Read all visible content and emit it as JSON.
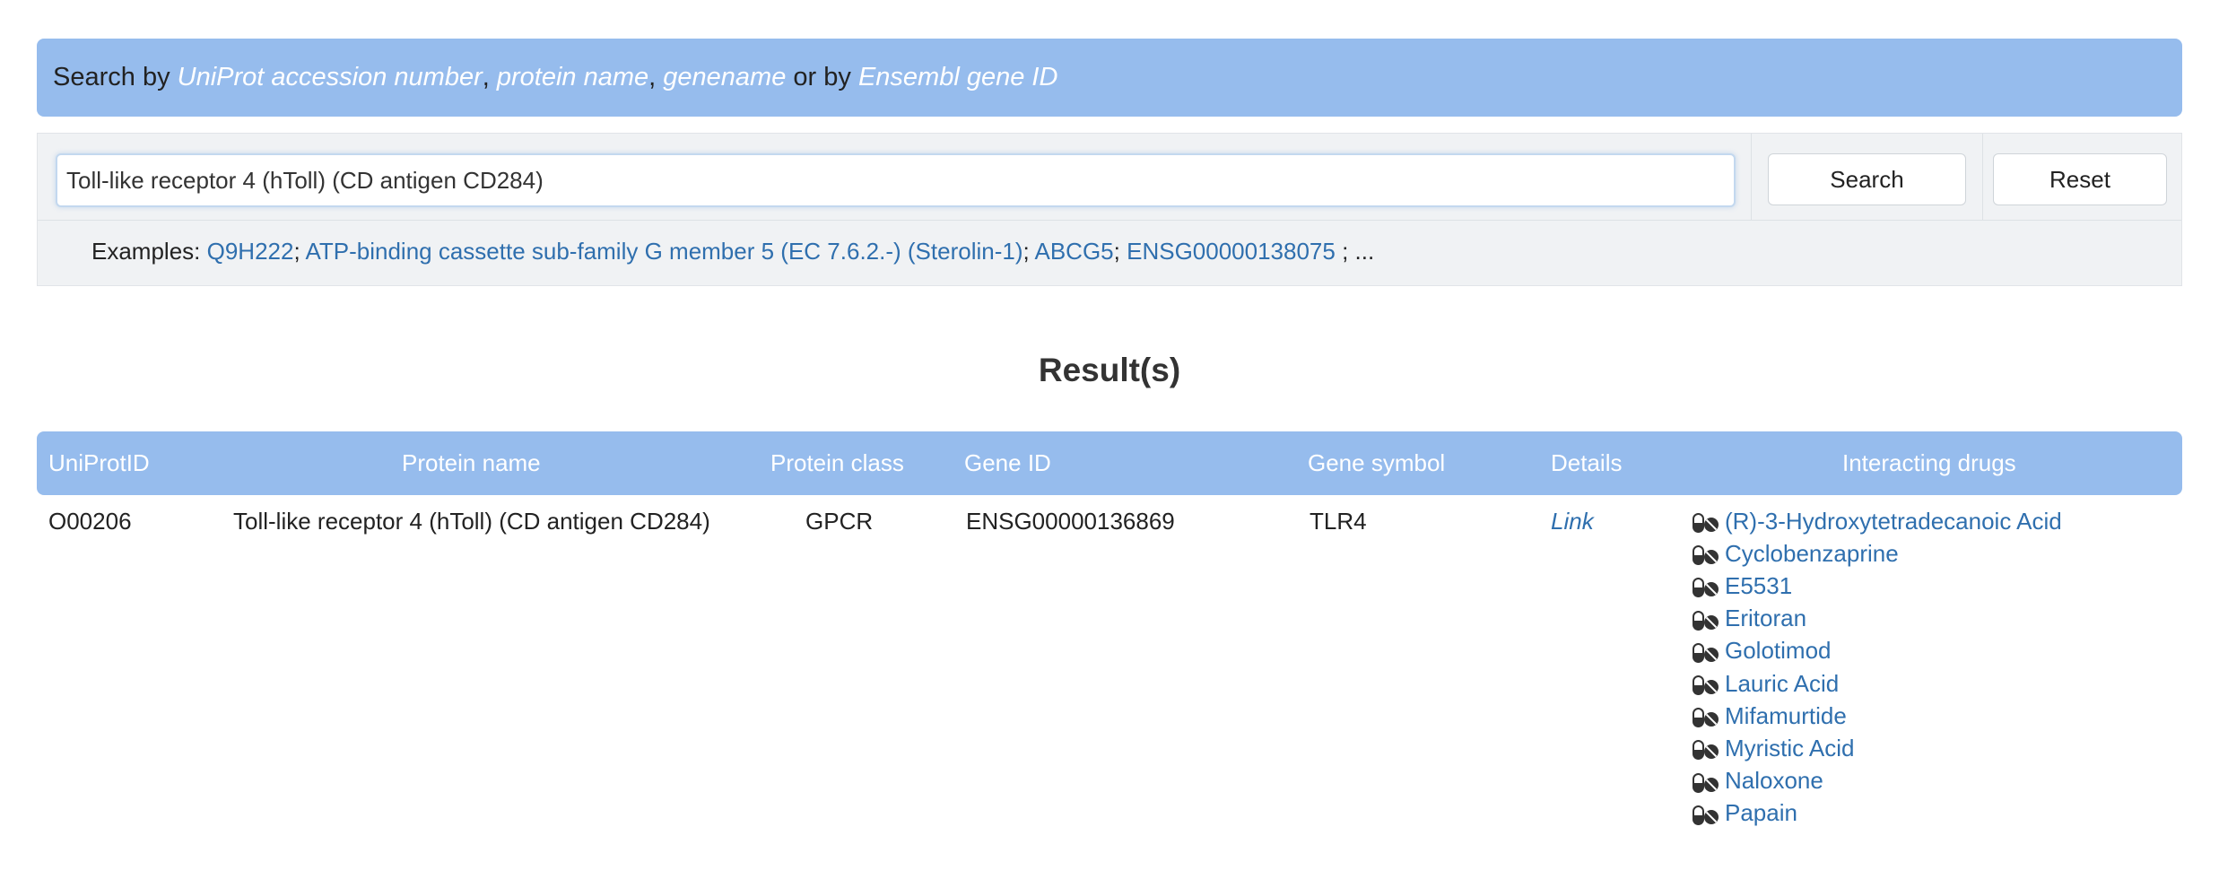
{
  "banner": {
    "prefix": "Search by ",
    "term1": "UniProt accession number",
    "sep1": ", ",
    "term2": "protein name",
    "sep2": ", ",
    "term3": "genename",
    "sep3": " or by ",
    "term4": "Ensembl gene ID"
  },
  "search": {
    "value": "Toll-like receptor 4 (hToll) (CD antigen CD284)",
    "search_label": "Search",
    "reset_label": "Reset"
  },
  "examples": {
    "label": "Examples: ",
    "items": [
      "Q9H222",
      "ATP-binding cassette sub-family G member 5 (EC 7.6.2.-) (Sterolin-1)",
      "ABCG5",
      "ENSG00000138075"
    ],
    "sep": "; ",
    "tail": " ; ..."
  },
  "results": {
    "title": "Result(s)",
    "columns": [
      "UniProtID",
      "Protein name",
      "Protein class",
      "Gene ID",
      "Gene symbol",
      "Details",
      "Interacting drugs"
    ],
    "row": {
      "uniprot_id": "O00206",
      "protein_name": "Toll-like receptor 4 (hToll) (CD antigen CD284)",
      "protein_class": "GPCR",
      "gene_id": "ENSG00000136869",
      "gene_symbol": "TLR4",
      "details_link": "Link",
      "drugs": [
        "(R)-3-Hydroxytetradecanoic Acid",
        "Cyclobenzaprine",
        "E5531",
        "Eritoran",
        "Golotimod",
        "Lauric Acid",
        "Mifamurtide",
        "Myristic Acid",
        "Naloxone",
        "Papain"
      ],
      "drug_icon": "pills-icon"
    }
  },
  "colors": {
    "header_bg": "#96bced",
    "link": "#2f6fae"
  }
}
